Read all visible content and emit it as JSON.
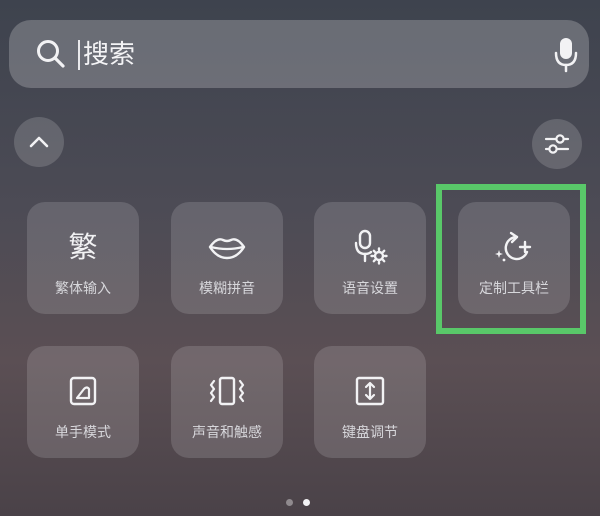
{
  "search": {
    "placeholder": "搜索"
  },
  "icons": {
    "search": "search-icon",
    "mic": "microphone-icon",
    "collapse": "chevron-up-icon",
    "settings": "sliders-icon"
  },
  "tools": [
    {
      "label": "繁体输入",
      "icon": "traditional-chinese-icon",
      "glyph": "繁"
    },
    {
      "label": "模糊拼音",
      "icon": "lips-icon"
    },
    {
      "label": "语音设置",
      "icon": "voice-settings-icon"
    },
    {
      "label": "定制工具栏",
      "icon": "customize-toolbar-icon"
    },
    {
      "label": "单手模式",
      "icon": "one-hand-mode-icon"
    },
    {
      "label": "声音和触感",
      "icon": "sound-vibration-icon"
    },
    {
      "label": "键盘调节",
      "icon": "keyboard-resize-icon"
    }
  ],
  "pagination": {
    "current_page": 2,
    "total_pages": 2
  },
  "colors": {
    "highlight": "#59c869",
    "text": "#f3f3f5"
  }
}
